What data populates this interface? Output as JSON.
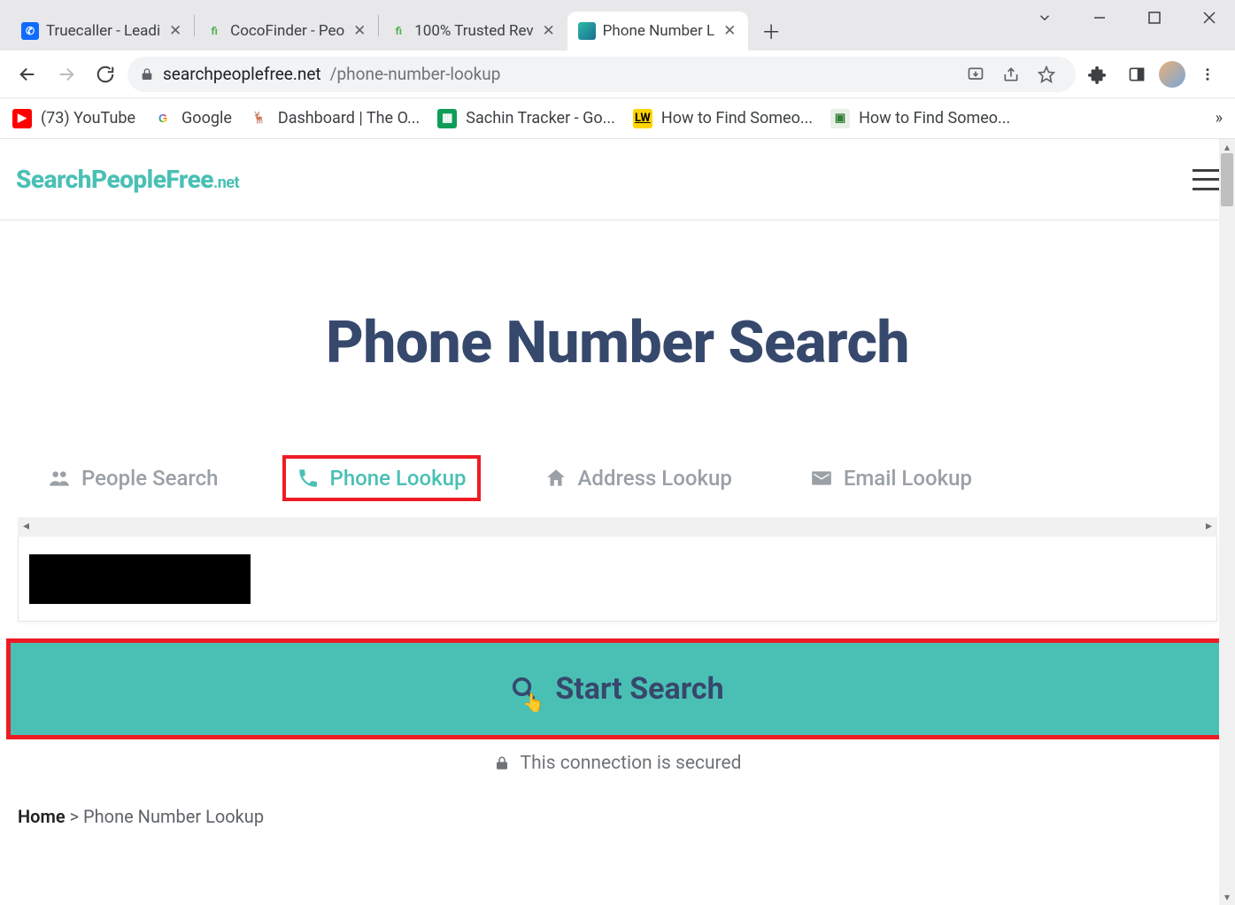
{
  "browser": {
    "tabs": [
      {
        "title": "Truecaller - Leadi"
      },
      {
        "title": "CocoFinder - Peo"
      },
      {
        "title": "100% Trusted Rev"
      },
      {
        "title": "Phone Number L"
      }
    ],
    "url_host": "searchpeoplefree.net",
    "url_path": "/phone-number-lookup"
  },
  "bookmarks": [
    {
      "label": "(73) YouTube"
    },
    {
      "label": "Google"
    },
    {
      "label": "Dashboard | The O..."
    },
    {
      "label": "Sachin Tracker - Go..."
    },
    {
      "label": "How to Find Someo..."
    },
    {
      "label": "How to Find Someo..."
    }
  ],
  "site": {
    "logo_main": "SearchPeopleFree",
    "logo_tld": ".net"
  },
  "hero": {
    "title": "Phone Number Search"
  },
  "search_tabs": {
    "people": "People Search",
    "phone": "Phone Lookup",
    "address": "Address Lookup",
    "email": "Email Lookup"
  },
  "start_button": "Start Search",
  "secure_text": "This connection is secured",
  "breadcrumb": {
    "home": "Home",
    "sep": ">",
    "current": "Phone Number Lookup"
  }
}
